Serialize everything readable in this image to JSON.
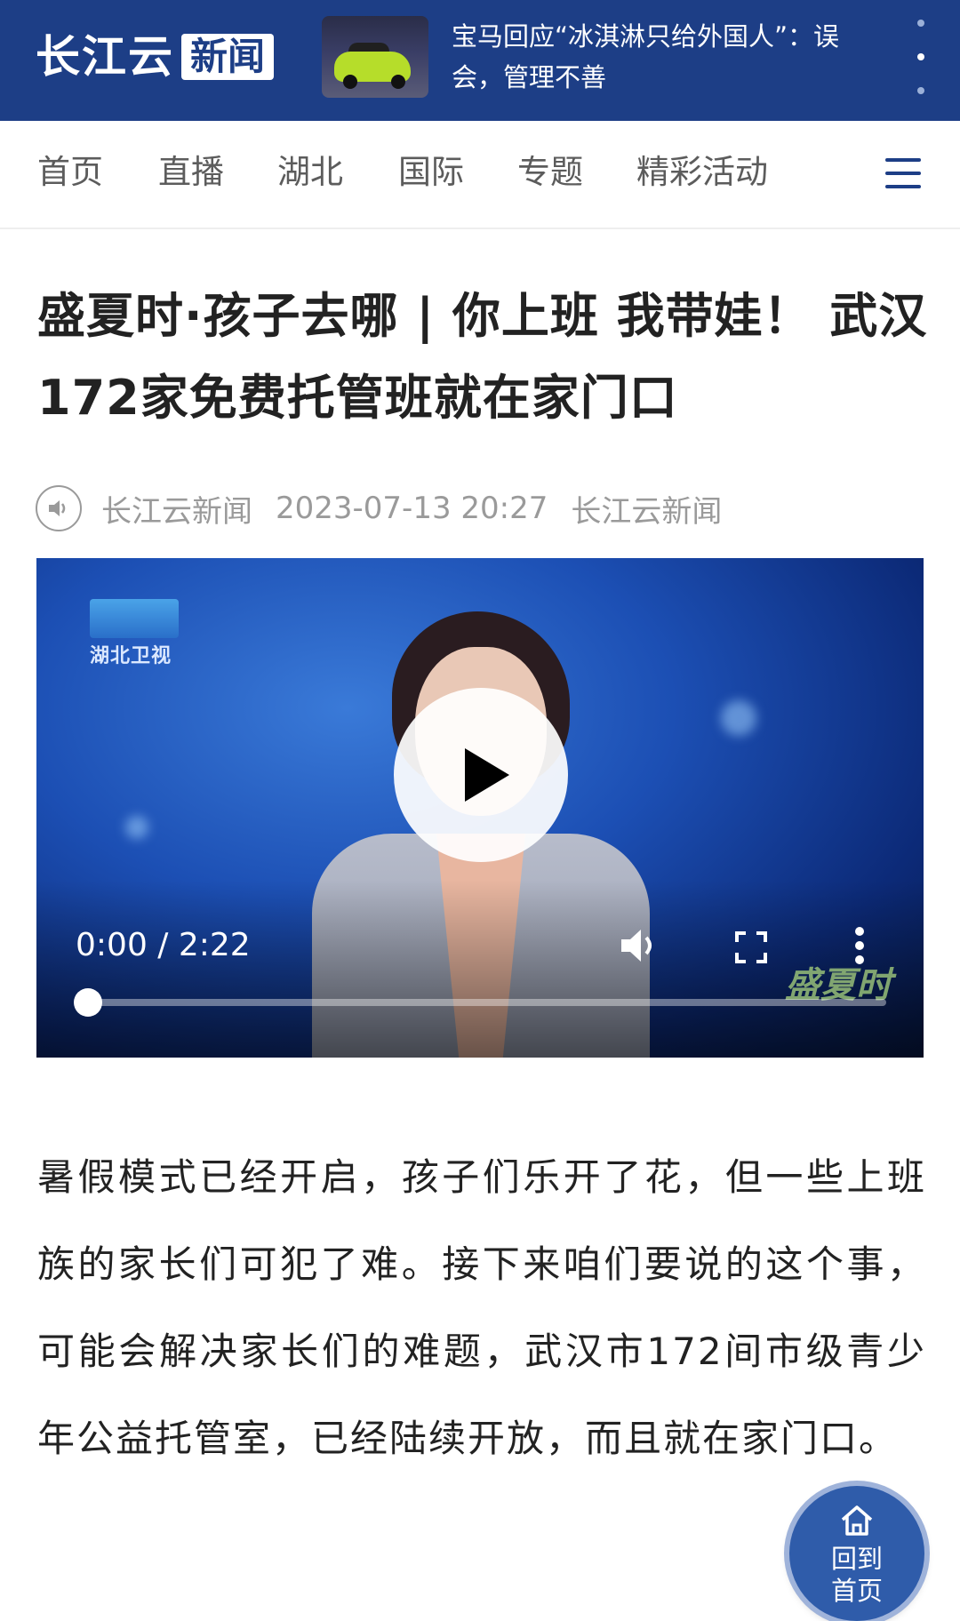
{
  "header": {
    "logo_text": "长江云",
    "logo_box": "新闻",
    "headline": "宝马回应“冰淇淋只给外国人”：误会，管理不善",
    "menu_icon": "more-vertical-icon"
  },
  "nav": {
    "items": [
      {
        "label": "首页"
      },
      {
        "label": "直播"
      },
      {
        "label": "湖北"
      },
      {
        "label": "国际"
      },
      {
        "label": "专题"
      },
      {
        "label": "精彩活动"
      }
    ],
    "menu_icon": "hamburger-menu-icon",
    "accent_color": "#1d3e86"
  },
  "article": {
    "title": "盛夏时·孩子去哪 | 你上班 我带娃！ 武汉172家免费托管班就在家门口",
    "source": "长江云新闻",
    "datetime": "2023-07-13 20:27",
    "author": "长江云新闻",
    "audio_icon": "speaker-icon",
    "body": "暑假模式已经开启，孩子们乐开了花，但一些上班族的家长们可犯了难。接下来咱们要说的这个事，可能会解决家长们的难题，武汉市172间市级青少年公益托管室，已经陆续开放，而且就在家门口。"
  },
  "video": {
    "station_name": "湖北卫视",
    "watermark": "盛夏时",
    "time_display": "0:00 / 2:22",
    "progress_fraction": 0,
    "icons": [
      "play-icon",
      "volume-icon",
      "fullscreen-icon",
      "more-vertical-icon"
    ]
  },
  "floating": {
    "home_line1": "回到",
    "home_line2": "首页",
    "icon": "home-icon",
    "color": "#2f5caa"
  }
}
